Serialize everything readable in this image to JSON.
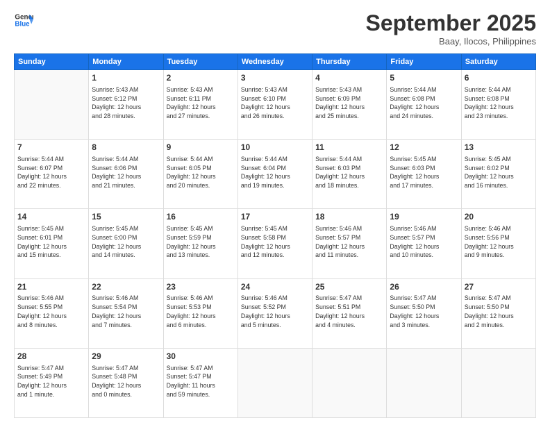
{
  "header": {
    "logo_line1": "General",
    "logo_line2": "Blue",
    "month": "September 2025",
    "location": "Baay, Ilocos, Philippines"
  },
  "weekdays": [
    "Sunday",
    "Monday",
    "Tuesday",
    "Wednesday",
    "Thursday",
    "Friday",
    "Saturday"
  ],
  "weeks": [
    [
      {
        "day": "",
        "info": ""
      },
      {
        "day": "1",
        "info": "Sunrise: 5:43 AM\nSunset: 6:12 PM\nDaylight: 12 hours\nand 28 minutes."
      },
      {
        "day": "2",
        "info": "Sunrise: 5:43 AM\nSunset: 6:11 PM\nDaylight: 12 hours\nand 27 minutes."
      },
      {
        "day": "3",
        "info": "Sunrise: 5:43 AM\nSunset: 6:10 PM\nDaylight: 12 hours\nand 26 minutes."
      },
      {
        "day": "4",
        "info": "Sunrise: 5:43 AM\nSunset: 6:09 PM\nDaylight: 12 hours\nand 25 minutes."
      },
      {
        "day": "5",
        "info": "Sunrise: 5:44 AM\nSunset: 6:08 PM\nDaylight: 12 hours\nand 24 minutes."
      },
      {
        "day": "6",
        "info": "Sunrise: 5:44 AM\nSunset: 6:08 PM\nDaylight: 12 hours\nand 23 minutes."
      }
    ],
    [
      {
        "day": "7",
        "info": "Sunrise: 5:44 AM\nSunset: 6:07 PM\nDaylight: 12 hours\nand 22 minutes."
      },
      {
        "day": "8",
        "info": "Sunrise: 5:44 AM\nSunset: 6:06 PM\nDaylight: 12 hours\nand 21 minutes."
      },
      {
        "day": "9",
        "info": "Sunrise: 5:44 AM\nSunset: 6:05 PM\nDaylight: 12 hours\nand 20 minutes."
      },
      {
        "day": "10",
        "info": "Sunrise: 5:44 AM\nSunset: 6:04 PM\nDaylight: 12 hours\nand 19 minutes."
      },
      {
        "day": "11",
        "info": "Sunrise: 5:44 AM\nSunset: 6:03 PM\nDaylight: 12 hours\nand 18 minutes."
      },
      {
        "day": "12",
        "info": "Sunrise: 5:45 AM\nSunset: 6:03 PM\nDaylight: 12 hours\nand 17 minutes."
      },
      {
        "day": "13",
        "info": "Sunrise: 5:45 AM\nSunset: 6:02 PM\nDaylight: 12 hours\nand 16 minutes."
      }
    ],
    [
      {
        "day": "14",
        "info": "Sunrise: 5:45 AM\nSunset: 6:01 PM\nDaylight: 12 hours\nand 15 minutes."
      },
      {
        "day": "15",
        "info": "Sunrise: 5:45 AM\nSunset: 6:00 PM\nDaylight: 12 hours\nand 14 minutes."
      },
      {
        "day": "16",
        "info": "Sunrise: 5:45 AM\nSunset: 5:59 PM\nDaylight: 12 hours\nand 13 minutes."
      },
      {
        "day": "17",
        "info": "Sunrise: 5:45 AM\nSunset: 5:58 PM\nDaylight: 12 hours\nand 12 minutes."
      },
      {
        "day": "18",
        "info": "Sunrise: 5:46 AM\nSunset: 5:57 PM\nDaylight: 12 hours\nand 11 minutes."
      },
      {
        "day": "19",
        "info": "Sunrise: 5:46 AM\nSunset: 5:57 PM\nDaylight: 12 hours\nand 10 minutes."
      },
      {
        "day": "20",
        "info": "Sunrise: 5:46 AM\nSunset: 5:56 PM\nDaylight: 12 hours\nand 9 minutes."
      }
    ],
    [
      {
        "day": "21",
        "info": "Sunrise: 5:46 AM\nSunset: 5:55 PM\nDaylight: 12 hours\nand 8 minutes."
      },
      {
        "day": "22",
        "info": "Sunrise: 5:46 AM\nSunset: 5:54 PM\nDaylight: 12 hours\nand 7 minutes."
      },
      {
        "day": "23",
        "info": "Sunrise: 5:46 AM\nSunset: 5:53 PM\nDaylight: 12 hours\nand 6 minutes."
      },
      {
        "day": "24",
        "info": "Sunrise: 5:46 AM\nSunset: 5:52 PM\nDaylight: 12 hours\nand 5 minutes."
      },
      {
        "day": "25",
        "info": "Sunrise: 5:47 AM\nSunset: 5:51 PM\nDaylight: 12 hours\nand 4 minutes."
      },
      {
        "day": "26",
        "info": "Sunrise: 5:47 AM\nSunset: 5:50 PM\nDaylight: 12 hours\nand 3 minutes."
      },
      {
        "day": "27",
        "info": "Sunrise: 5:47 AM\nSunset: 5:50 PM\nDaylight: 12 hours\nand 2 minutes."
      }
    ],
    [
      {
        "day": "28",
        "info": "Sunrise: 5:47 AM\nSunset: 5:49 PM\nDaylight: 12 hours\nand 1 minute."
      },
      {
        "day": "29",
        "info": "Sunrise: 5:47 AM\nSunset: 5:48 PM\nDaylight: 12 hours\nand 0 minutes."
      },
      {
        "day": "30",
        "info": "Sunrise: 5:47 AM\nSunset: 5:47 PM\nDaylight: 11 hours\nand 59 minutes."
      },
      {
        "day": "",
        "info": ""
      },
      {
        "day": "",
        "info": ""
      },
      {
        "day": "",
        "info": ""
      },
      {
        "day": "",
        "info": ""
      }
    ]
  ]
}
